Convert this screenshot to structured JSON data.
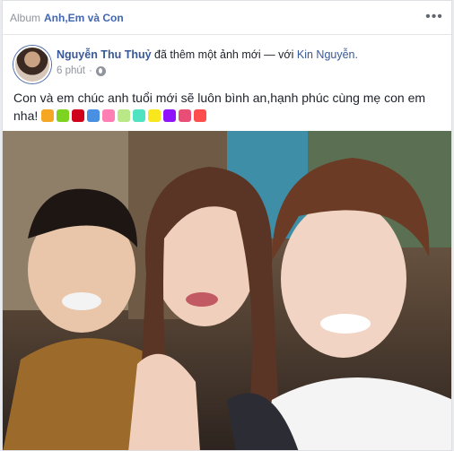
{
  "album": {
    "prefix": "Album",
    "name": "Anh,Em và Con"
  },
  "post": {
    "author": "Nguyễn Thu Thuỷ",
    "action": "đã thêm một ảnh mới — với",
    "tagged": "Kin Nguyễn.",
    "time": "6 phút",
    "privacy_icon": "globe-icon",
    "caption": "Con và em chúc anh tuổi mới sẽ luôn bình an,hạnh phúc cùng mẹ con em nha!"
  },
  "emojis": [
    "family-icon",
    "party-icon",
    "cake-icon",
    "cupcake-icon",
    "lollipop-icon",
    "balloon-icon",
    "cocktail-icon",
    "confetti-icon",
    "sparkler-icon",
    "ribbon-icon",
    "gift-icon"
  ],
  "colors": {
    "link": "#385898",
    "album": "#4267b2",
    "meta": "#90949c"
  }
}
